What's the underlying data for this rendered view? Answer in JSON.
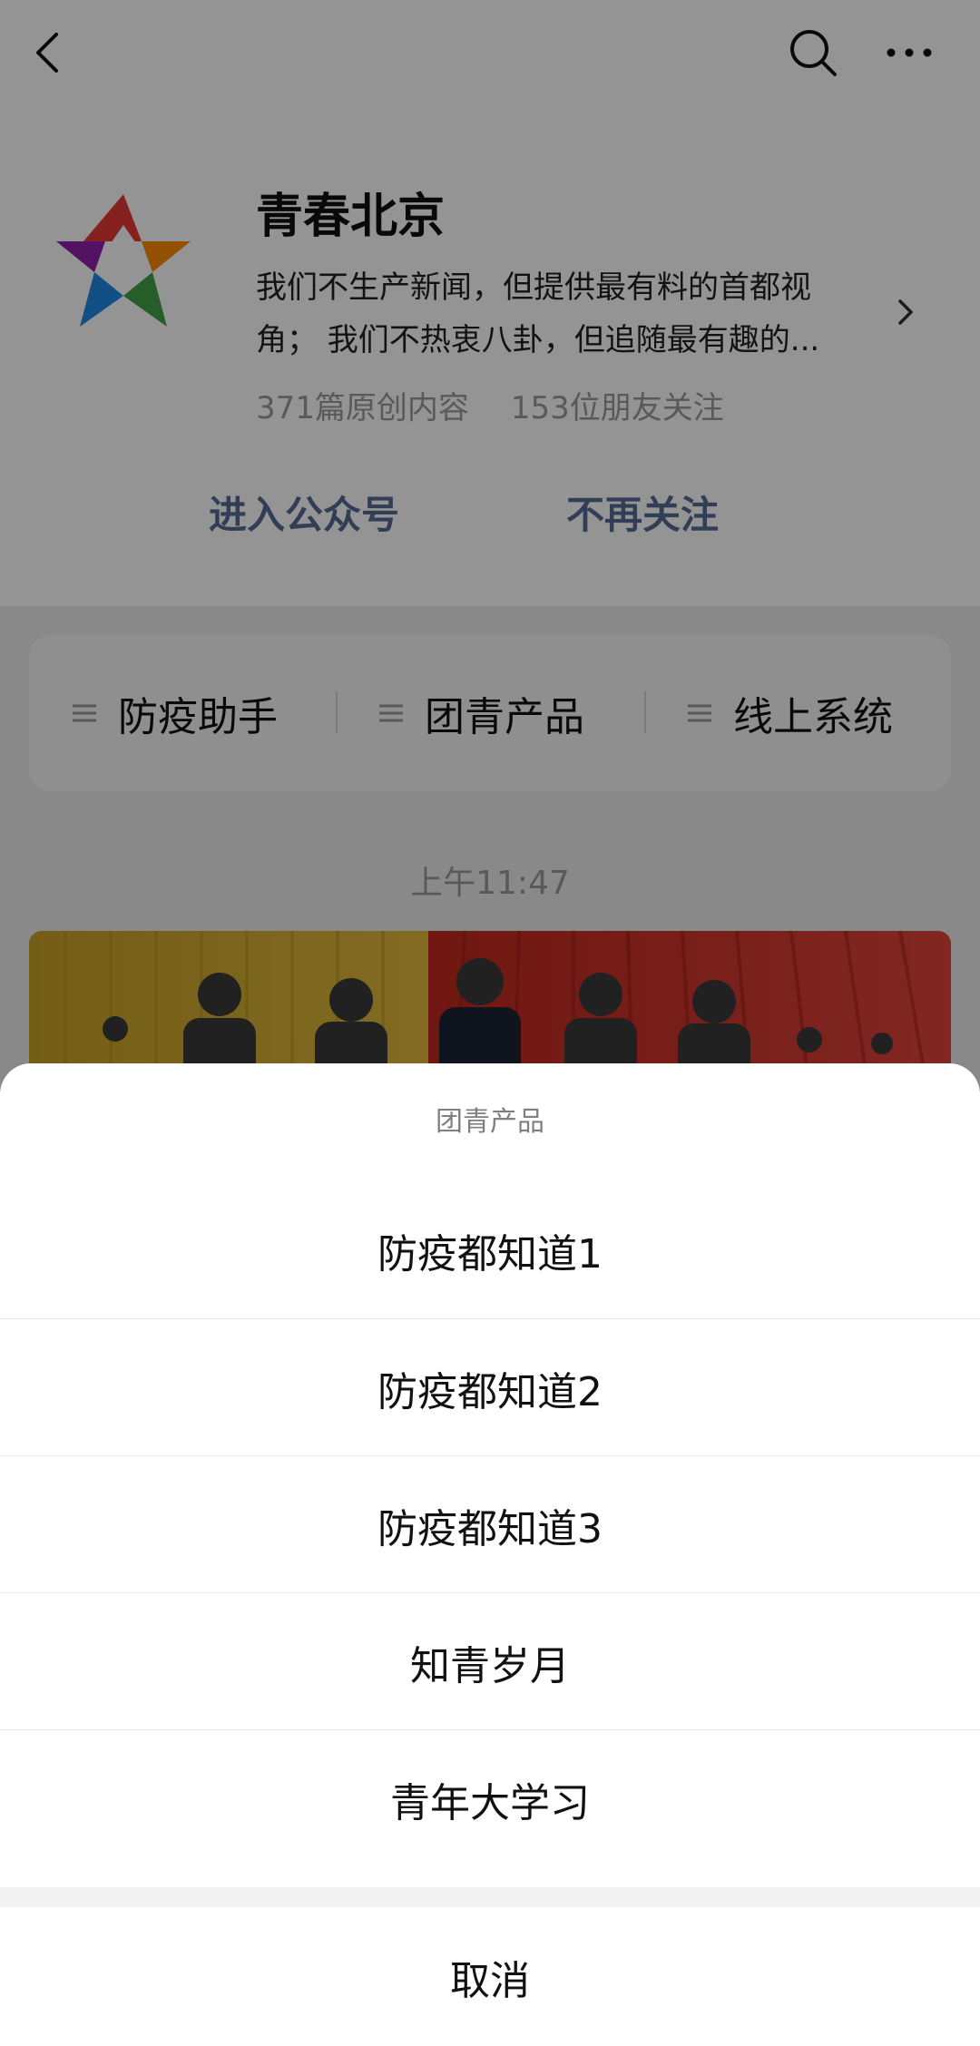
{
  "nav": {
    "back_icon": "back-icon",
    "search_icon": "search-icon",
    "more_icon": "more-icon"
  },
  "account": {
    "name": "青春北京",
    "description_line1": "我们不生产新闻，但提供最有料的首都视",
    "description_line2": "角； 我们不热衷八卦，但追随最有趣的...",
    "original_count": "371篇原创内容",
    "friends_following": "153位朋友关注",
    "enter_label": "进入公众号",
    "unfollow_label": "不再关注"
  },
  "menu": {
    "items": [
      {
        "label": "防疫助手"
      },
      {
        "label": "团青产品"
      },
      {
        "label": "线上系统"
      }
    ]
  },
  "feed": {
    "timestamp": "上午11:47"
  },
  "action_sheet": {
    "title": "团青产品",
    "options": [
      {
        "label": "防疫都知道1"
      },
      {
        "label": "防疫都知道2"
      },
      {
        "label": "防疫都知道3"
      },
      {
        "label": "知青岁月"
      },
      {
        "label": "青年大学习"
      }
    ],
    "cancel_label": "取消"
  },
  "colors": {
    "link": "#576b95",
    "overlay": "rgba(0,0,0,0.42)"
  }
}
